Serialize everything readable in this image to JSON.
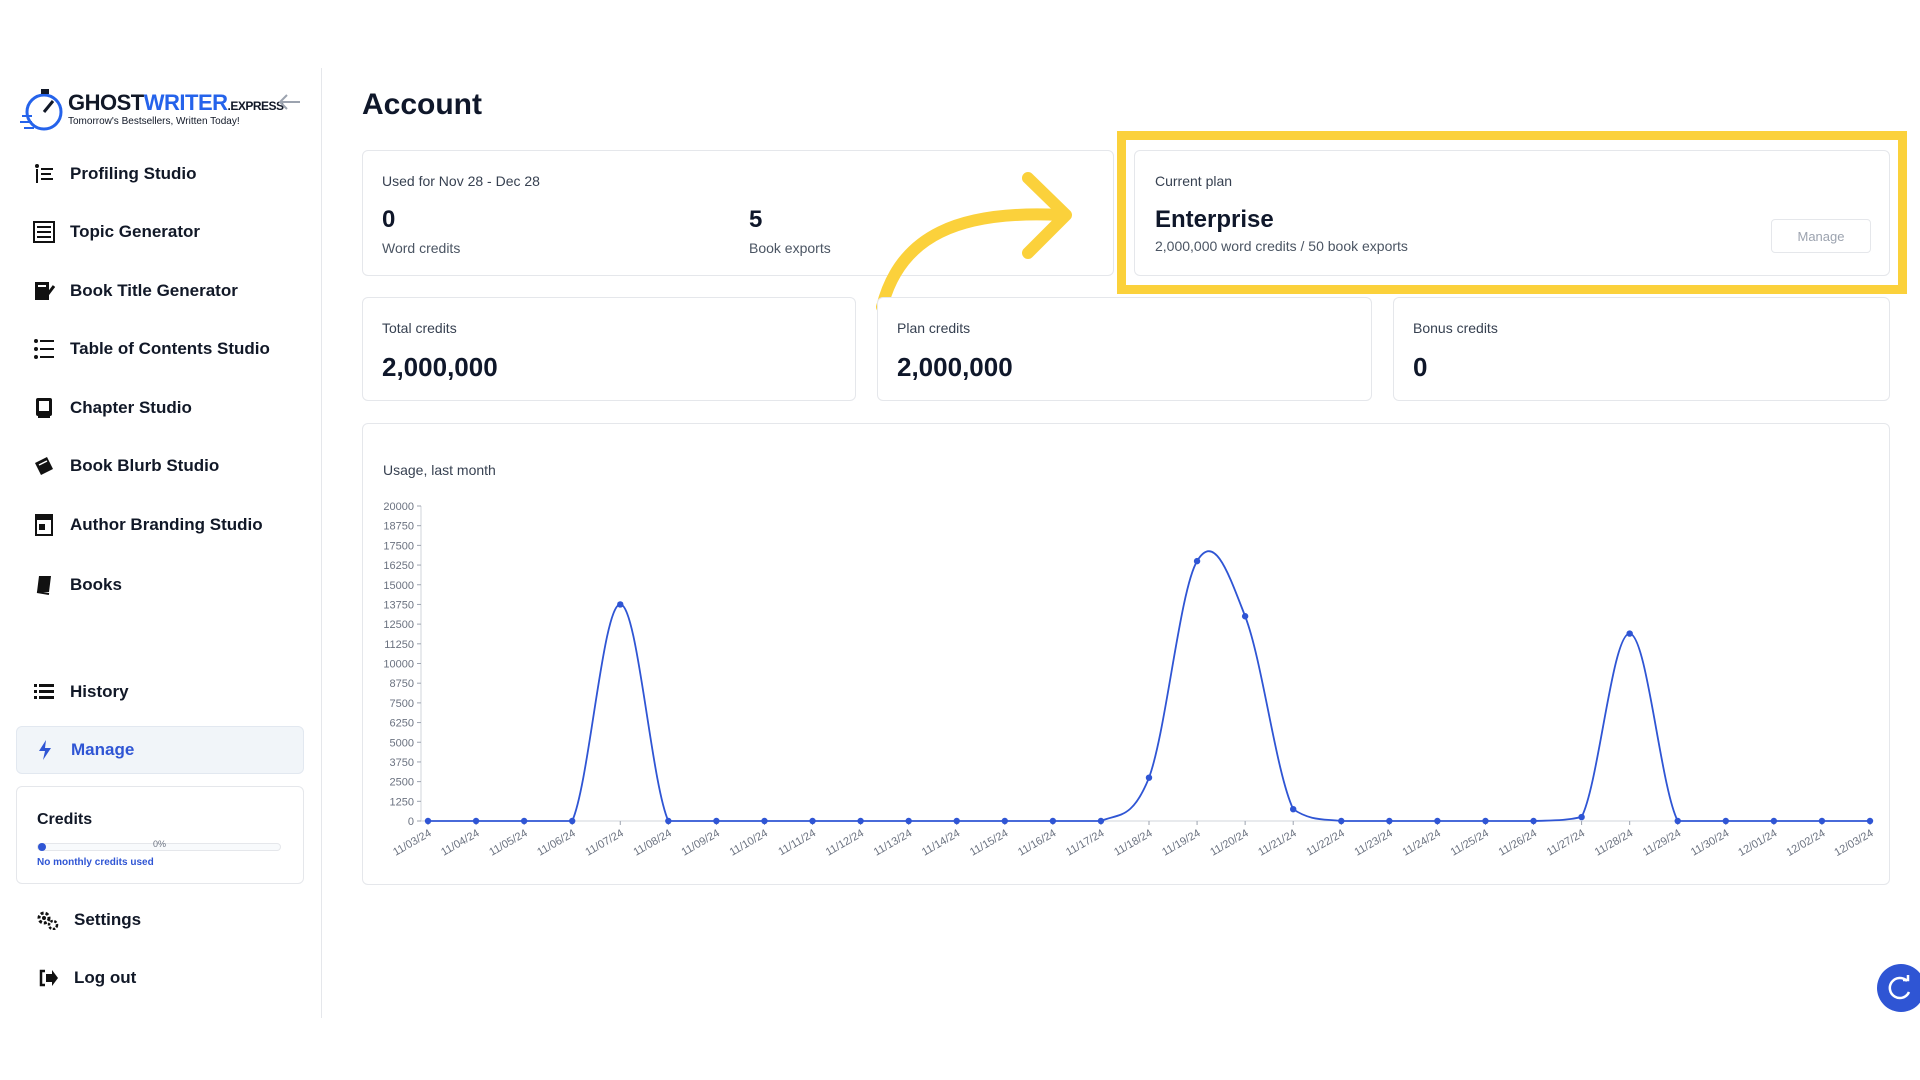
{
  "brand": {
    "name_part1": "GHOST",
    "name_part2": "WRITER",
    "name_suffix": ".EXPRESS",
    "tagline": "Tomorrow's Bestsellers, Written Today!"
  },
  "sidebar": {
    "items": [
      {
        "label": "Profiling Studio",
        "icon": "profiling-icon"
      },
      {
        "label": "Topic Generator",
        "icon": "topic-icon"
      },
      {
        "label": "Book Title Generator",
        "icon": "book-title-icon"
      },
      {
        "label": "Table of Contents Studio",
        "icon": "list-icon"
      },
      {
        "label": "Chapter Studio",
        "icon": "chapter-icon"
      },
      {
        "label": "Book Blurb Studio",
        "icon": "blurb-icon"
      },
      {
        "label": "Author Branding Studio",
        "icon": "branding-icon"
      },
      {
        "label": "Books",
        "icon": "book-icon"
      }
    ],
    "history_label": "History",
    "manage_label": "Manage",
    "settings_label": "Settings",
    "logout_label": "Log out",
    "credits": {
      "title": "Credits",
      "percent_text": "0%",
      "percent_value": 0,
      "note": "No monthly credits used"
    }
  },
  "main": {
    "title": "Account",
    "usage": {
      "period_label": "Used for Nov 28 - Dec 28",
      "word_credits_value": "0",
      "word_credits_label": "Word credits",
      "book_exports_value": "5",
      "book_exports_label": "Book exports"
    },
    "plan": {
      "label": "Current plan",
      "name": "Enterprise",
      "details": "2,000,000 word credits / 50 book exports",
      "manage_button": "Manage"
    },
    "totals": [
      {
        "label": "Total credits",
        "value": "2,000,000"
      },
      {
        "label": "Plan credits",
        "value": "2,000,000"
      },
      {
        "label": "Bonus credits",
        "value": "0"
      }
    ]
  },
  "colors": {
    "accent": "#2f55d4",
    "highlight": "#fbd13b",
    "line": "#2f55d4"
  },
  "chart_data": {
    "type": "line",
    "title": "Usage, last month",
    "x": [
      "11/03/24",
      "11/04/24",
      "11/05/24",
      "11/06/24",
      "11/07/24",
      "11/08/24",
      "11/09/24",
      "11/10/24",
      "11/11/24",
      "11/12/24",
      "11/13/24",
      "11/14/24",
      "11/15/24",
      "11/16/24",
      "11/17/24",
      "11/18/24",
      "11/19/24",
      "11/20/24",
      "11/21/24",
      "11/22/24",
      "11/23/24",
      "11/24/24",
      "11/25/24",
      "11/26/24",
      "11/27/24",
      "11/28/24",
      "11/29/24",
      "11/30/24",
      "12/01/24",
      "12/02/24",
      "12/03/24"
    ],
    "values": [
      0,
      0,
      0,
      0,
      13750,
      0,
      0,
      0,
      0,
      0,
      0,
      0,
      0,
      0,
      0,
      2750,
      16500,
      13000,
      750,
      0,
      0,
      0,
      0,
      0,
      250,
      11900,
      0,
      0,
      0,
      0,
      0
    ],
    "y_ticks": [
      0,
      1250,
      2500,
      3750,
      5000,
      6250,
      7500,
      8750,
      10000,
      11250,
      12500,
      13750,
      15000,
      16250,
      17500,
      18750,
      20000
    ],
    "ylim": [
      0,
      20000
    ],
    "grid": false,
    "legend": "none"
  }
}
